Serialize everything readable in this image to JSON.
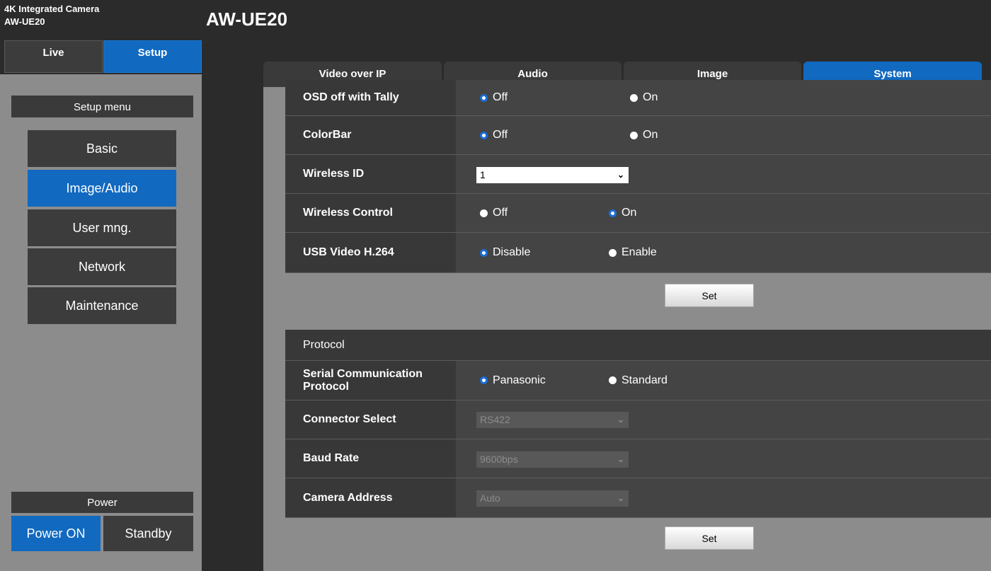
{
  "header": {
    "product_line1": "4K Integrated Camera",
    "product_line2": "AW-UE20",
    "page_title": "AW-UE20"
  },
  "top_nav": {
    "live": "Live",
    "setup": "Setup",
    "active": "Setup"
  },
  "setup_menu": {
    "title": "Setup menu",
    "items": [
      "Basic",
      "Image/Audio",
      "User mng.",
      "Network",
      "Maintenance"
    ],
    "active": "Image/Audio"
  },
  "power": {
    "title": "Power",
    "on_label": "Power ON",
    "standby_label": "Standby",
    "active": "Power ON"
  },
  "tabs": {
    "items": [
      "Video over IP",
      "Audio",
      "Image",
      "System"
    ],
    "active": "System"
  },
  "settings": {
    "osd_off_with_tally": {
      "label": "OSD off with Tally",
      "options": [
        "Off",
        "On"
      ],
      "selected": "Off"
    },
    "colorbar": {
      "label": "ColorBar",
      "options": [
        "Off",
        "On"
      ],
      "selected": "Off"
    },
    "wireless_id": {
      "label": "Wireless ID",
      "value": "1"
    },
    "wireless_control": {
      "label": "Wireless Control",
      "options": [
        "Off",
        "On"
      ],
      "selected": "On"
    },
    "usb_video_h264": {
      "label": "USB Video H.264",
      "options": [
        "Disable",
        "Enable"
      ],
      "selected": "Disable"
    },
    "set_label": "Set"
  },
  "protocol": {
    "title": "Protocol",
    "serial_communication_protocol": {
      "label": "Serial Communication Protocol",
      "options": [
        "Panasonic",
        "Standard"
      ],
      "selected": "Panasonic"
    },
    "connector_select": {
      "label": "Connector Select",
      "value": "RS422",
      "disabled": true
    },
    "baud_rate": {
      "label": "Baud Rate",
      "value": "9600bps",
      "disabled": true
    },
    "camera_address": {
      "label": "Camera Address",
      "value": "Auto",
      "disabled": true
    },
    "set_label": "Set"
  },
  "colors": {
    "accent": "#1169c0",
    "panel": "#8c8c8c",
    "dark": "#2b2b2b",
    "row": "#444444"
  }
}
